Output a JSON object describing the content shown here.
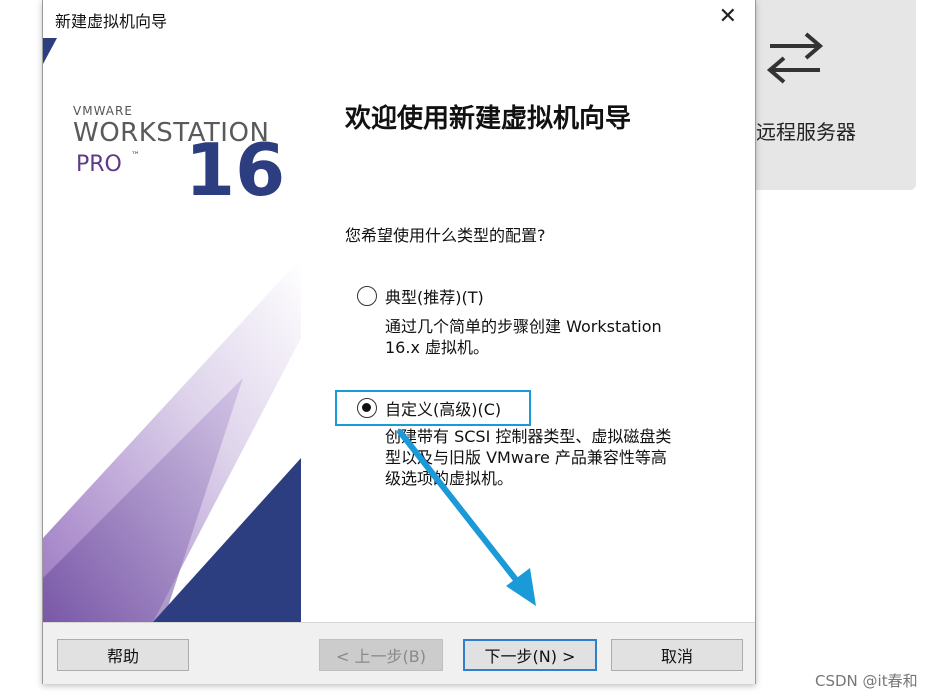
{
  "background": {
    "remote_label": "远程服务器",
    "icon": "swap-arrows-icon"
  },
  "dialog": {
    "title": "新建虚拟机向导",
    "close": "✕",
    "brand": {
      "vendor": "VMWARE",
      "product": "WORKSTATION",
      "edition": "PRO",
      "trademark": "™",
      "version": "16"
    },
    "heading": "欢迎使用新建虚拟机向导",
    "question": "您希望使用什么类型的配置?",
    "options": [
      {
        "label": "典型(推荐)(T)",
        "description": "通过几个简单的步骤创建 Workstation\n16.x 虚拟机。",
        "selected": false
      },
      {
        "label": "自定义(高级)(C)",
        "description": "创建带有 SCSI 控制器类型、虚拟磁盘类\n型以及与旧版 VMware 产品兼容性等高\n级选项的虚拟机。",
        "selected": true
      }
    ],
    "buttons": {
      "help": "帮助",
      "back": "< 上一步(B)",
      "next": "下一步(N) >",
      "cancel": "取消"
    },
    "colors": {
      "annotation": "#1a9ad8",
      "brand_blue": "#2d3e80",
      "brand_purple": "#5d3b8a"
    }
  },
  "watermark": "CSDN @it春和"
}
